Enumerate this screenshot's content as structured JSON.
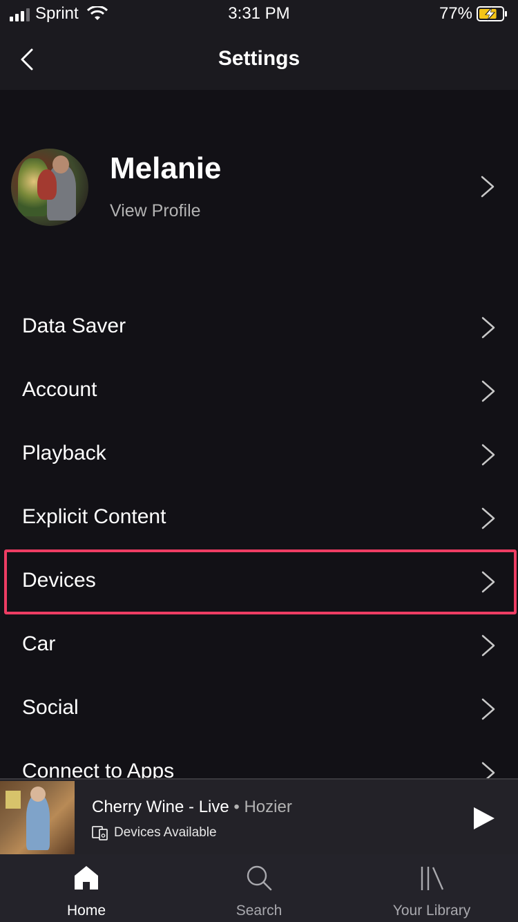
{
  "status_bar": {
    "carrier": "Sprint",
    "time": "3:31 PM",
    "battery": "77%",
    "battery_level": 0.77
  },
  "nav": {
    "title": "Settings",
    "back_icon": "chevron-left-icon"
  },
  "profile": {
    "name": "Melanie",
    "subtitle": "View Profile"
  },
  "settings": [
    {
      "label": "Data Saver"
    },
    {
      "label": "Account"
    },
    {
      "label": "Playback"
    },
    {
      "label": "Explicit Content"
    },
    {
      "label": "Devices",
      "highlighted": true
    },
    {
      "label": "Car"
    },
    {
      "label": "Social"
    },
    {
      "label": "Connect to Apps"
    }
  ],
  "highlight_color": "#ee3d63",
  "now_playing": {
    "track": "Cherry Wine - Live",
    "separator": "•",
    "artist": "Hozier",
    "devices": "Devices Available"
  },
  "tabs": [
    {
      "label": "Home",
      "icon": "home-icon",
      "active": true
    },
    {
      "label": "Search",
      "icon": "search-icon",
      "active": false
    },
    {
      "label": "Your Library",
      "icon": "library-icon",
      "active": false
    }
  ],
  "colors": {
    "background": "#121116",
    "bar": "#1b1a1f",
    "secondary_text": "#b3b3b3",
    "battery_charging": "#f5c518"
  }
}
